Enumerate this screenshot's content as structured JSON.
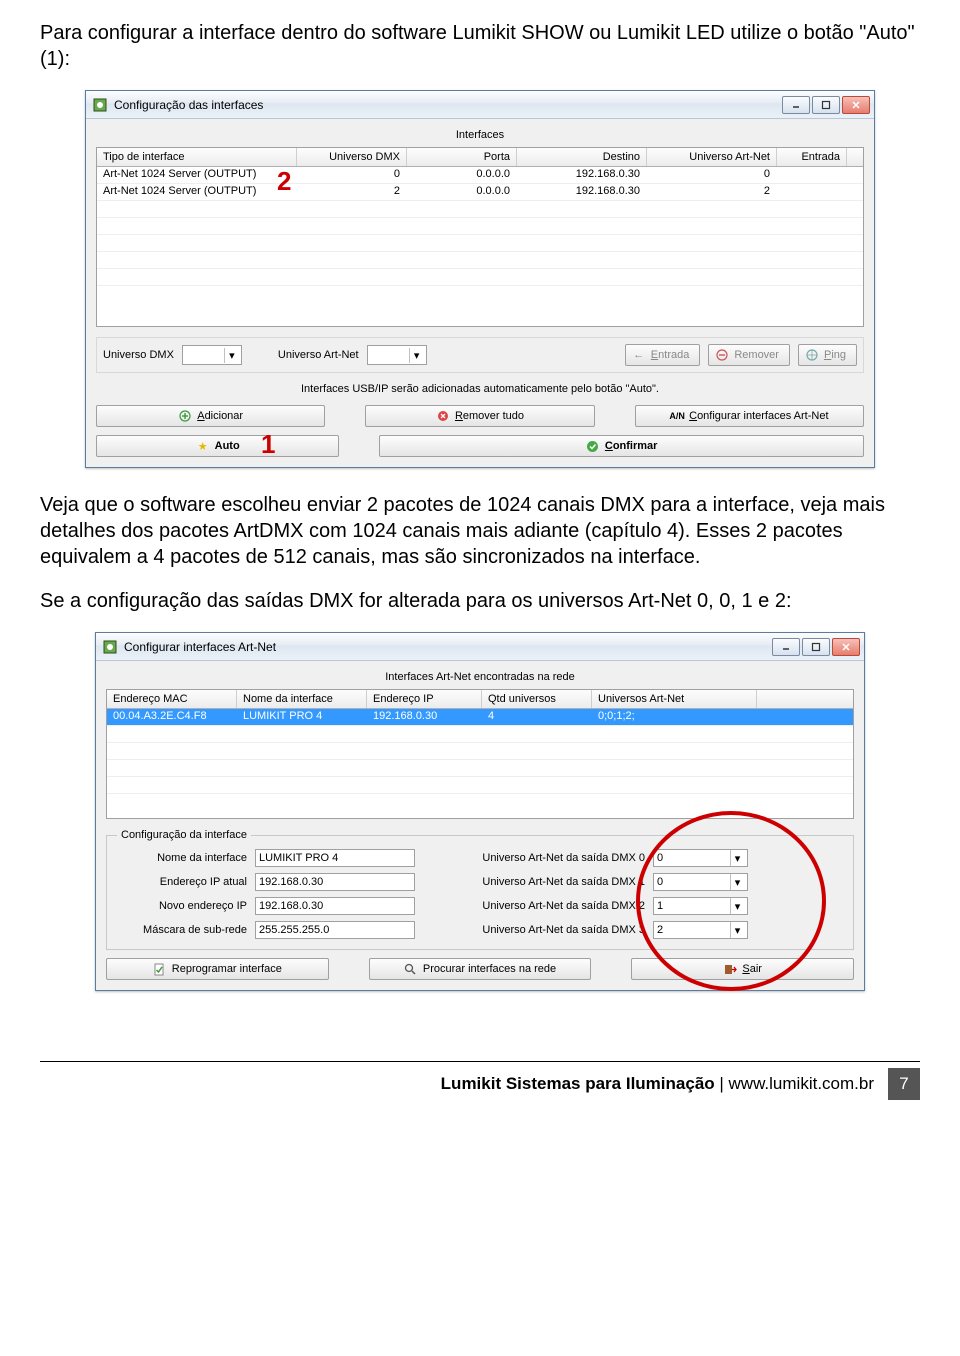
{
  "prose": {
    "p1": "Para configurar a interface dentro do software Lumikit SHOW ou Lumikit LED utilize o botão \"Auto\" (1):",
    "p2": "Veja que o software escolheu enviar 2 pacotes de 1024 canais DMX para a interface, veja mais detalhes dos pacotes ArtDMX com 1024 canais mais adiante (capítulo 4). Esses 2 pacotes equivalem a 4 pacotes de 512 canais, mas são sincronizados na interface.",
    "p3": "Se a configuração das saídas DMX for alterada para os universos Art-Net 0, 0, 1 e 2:"
  },
  "annotations": {
    "one": "1",
    "two": "2"
  },
  "window1": {
    "title": "Configuração das interfaces",
    "caption": "Interfaces",
    "columns": [
      "Tipo de interface",
      "Universo DMX",
      "Porta",
      "Destino",
      "Universo Art-Net",
      "Entrada"
    ],
    "rows": [
      {
        "c0": "Art-Net 1024 Server (OUTPUT)",
        "c1": "0",
        "c2": "0.0.0.0",
        "c3": "192.168.0.30",
        "c4": "0",
        "c5": ""
      },
      {
        "c0": "Art-Net 1024 Server (OUTPUT)",
        "c1": "2",
        "c2": "0.0.0.0",
        "c3": "192.168.0.30",
        "c4": "2",
        "c5": ""
      }
    ],
    "labels": {
      "universo_dmx": "Universo DMX",
      "universo_artnet": "Universo Art-Net",
      "entrada": "Entrada",
      "remover": "Remover",
      "ping": "Ping",
      "note": "Interfaces USB/IP serão adicionadas automaticamente pelo botão \"Auto\".",
      "adicionar": "Adicionar",
      "remover_tudo": "Remover tudo",
      "config_artnet": "Configurar interfaces Art-Net",
      "auto": "Auto",
      "confirmar": "Confirmar"
    }
  },
  "window2": {
    "title": "Configurar interfaces Art-Net",
    "caption": "Interfaces Art-Net encontradas na rede",
    "columns": [
      "Endereço MAC",
      "Nome da interface",
      "Endereço IP",
      "Qtd universos",
      "Universos Art-Net"
    ],
    "row": {
      "c0": "00.04.A3.2E.C4.F8",
      "c1": "LUMIKIT PRO 4",
      "c2": "192.168.0.30",
      "c3": "4",
      "c4": "0;0;1;2;"
    },
    "fieldset_legend": "Configuração da interface",
    "left": {
      "nome_label": "Nome da interface",
      "nome_val": "LUMIKIT PRO 4",
      "ip_atual_label": "Endereço IP atual",
      "ip_atual_val": "192.168.0.30",
      "novo_ip_label": "Novo endereço IP",
      "novo_ip_val": "192.168.0.30",
      "mask_label": "Máscara de sub-rede",
      "mask_val": "255.255.255.0"
    },
    "right": {
      "u0_label": "Universo Art-Net da saída DMX 0",
      "u0_val": "0",
      "u1_label": "Universo Art-Net da saída DMX 1",
      "u1_val": "0",
      "u2_label": "Universo Art-Net da saída DMX 2",
      "u2_val": "1",
      "u3_label": "Universo Art-Net da saída DMX 3",
      "u3_val": "2"
    },
    "buttons": {
      "reprogramar": "Reprogramar interface",
      "procurar": "Procurar interfaces na rede",
      "sair": "Sair"
    }
  },
  "footer": {
    "brand": "Lumikit Sistemas para Iluminação",
    "sep": " | ",
    "url": "www.lumikit.com.br",
    "page": "7"
  }
}
